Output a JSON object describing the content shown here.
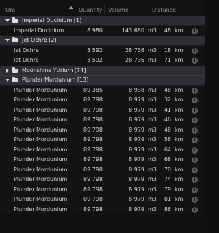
{
  "columns": {
    "ore": "Ore",
    "quantity": "Quantity",
    "volume": "Volume",
    "distance": "Distance"
  },
  "groups": [
    {
      "name": "Imperial Ducinium [1]",
      "expanded": true,
      "items": [
        {
          "name": "Imperial Ducinium",
          "quantity": "8 980",
          "volume": "143 680",
          "unit": "m3",
          "distance": "48",
          "dist_unit": "km"
        }
      ]
    },
    {
      "name": "Jet Ochre [2]",
      "expanded": true,
      "items": [
        {
          "name": "Jet Ochre",
          "quantity": "3 592",
          "volume": "28 736",
          "unit": "m3",
          "distance": "18",
          "dist_unit": "km"
        },
        {
          "name": "Jet Ochre",
          "quantity": "3 592",
          "volume": "28 736",
          "unit": "m3",
          "distance": "71",
          "dist_unit": "km"
        }
      ]
    },
    {
      "name": "Moonshine Ytirium [74]",
      "expanded": false,
      "items": []
    },
    {
      "name": "Plunder Mordunium [13]",
      "expanded": true,
      "items": [
        {
          "name": "Plunder Mordunium",
          "quantity": "89 385",
          "volume": "8 938",
          "unit": "m3",
          "distance": "48",
          "dist_unit": "km"
        },
        {
          "name": "Plunder Mordunium",
          "quantity": "89 798",
          "volume": "8 979",
          "unit": "m3",
          "distance": "32",
          "dist_unit": "km"
        },
        {
          "name": "Plunder Mordunium",
          "quantity": "89 798",
          "volume": "8 979",
          "unit": "m3",
          "distance": "41",
          "dist_unit": "km"
        },
        {
          "name": "Plunder Mordunium",
          "quantity": "89 798",
          "volume": "8 979",
          "unit": "m3",
          "distance": "46",
          "dist_unit": "km"
        },
        {
          "name": "Plunder Mordunium",
          "quantity": "89 798",
          "volume": "8 979",
          "unit": "m3",
          "distance": "48",
          "dist_unit": "km"
        },
        {
          "name": "Plunder Mordunium",
          "quantity": "89 798",
          "volume": "8 979",
          "unit": "m3",
          "distance": "56",
          "dist_unit": "km"
        },
        {
          "name": "Plunder Mordunium",
          "quantity": "89 798",
          "volume": "8 979",
          "unit": "m3",
          "distance": "64",
          "dist_unit": "km"
        },
        {
          "name": "Plunder Mordunium",
          "quantity": "89 798",
          "volume": "8 979",
          "unit": "m3",
          "distance": "68",
          "dist_unit": "km"
        },
        {
          "name": "Plunder Mordunium",
          "quantity": "89 798",
          "volume": "8 979",
          "unit": "m3",
          "distance": "70",
          "dist_unit": "km"
        },
        {
          "name": "Plunder Mordunium",
          "quantity": "89 798",
          "volume": "8 979",
          "unit": "m3",
          "distance": "74",
          "dist_unit": "km"
        },
        {
          "name": "Plunder Mordunium",
          "quantity": "89 798",
          "volume": "8 979",
          "unit": "m3",
          "distance": "79",
          "dist_unit": "km"
        },
        {
          "name": "Plunder Mordunium",
          "quantity": "89 798",
          "volume": "8 979",
          "unit": "m3",
          "distance": "81",
          "dist_unit": "km"
        },
        {
          "name": "Plunder Mordunium",
          "quantity": "89 798",
          "volume": "8 979",
          "unit": "m3",
          "distance": "86",
          "dist_unit": "km"
        }
      ]
    }
  ],
  "icons": {
    "folder": "folder-icon",
    "info": "info-icon",
    "expand": "chevron-down-icon",
    "collapse": "chevron-right-icon",
    "sort": "sort-ascending-icon"
  },
  "colors": {
    "background": "#0f1011",
    "group_row": "#2c2e31",
    "text": "#d4d4d4",
    "header_text": "#8f8f8f"
  }
}
